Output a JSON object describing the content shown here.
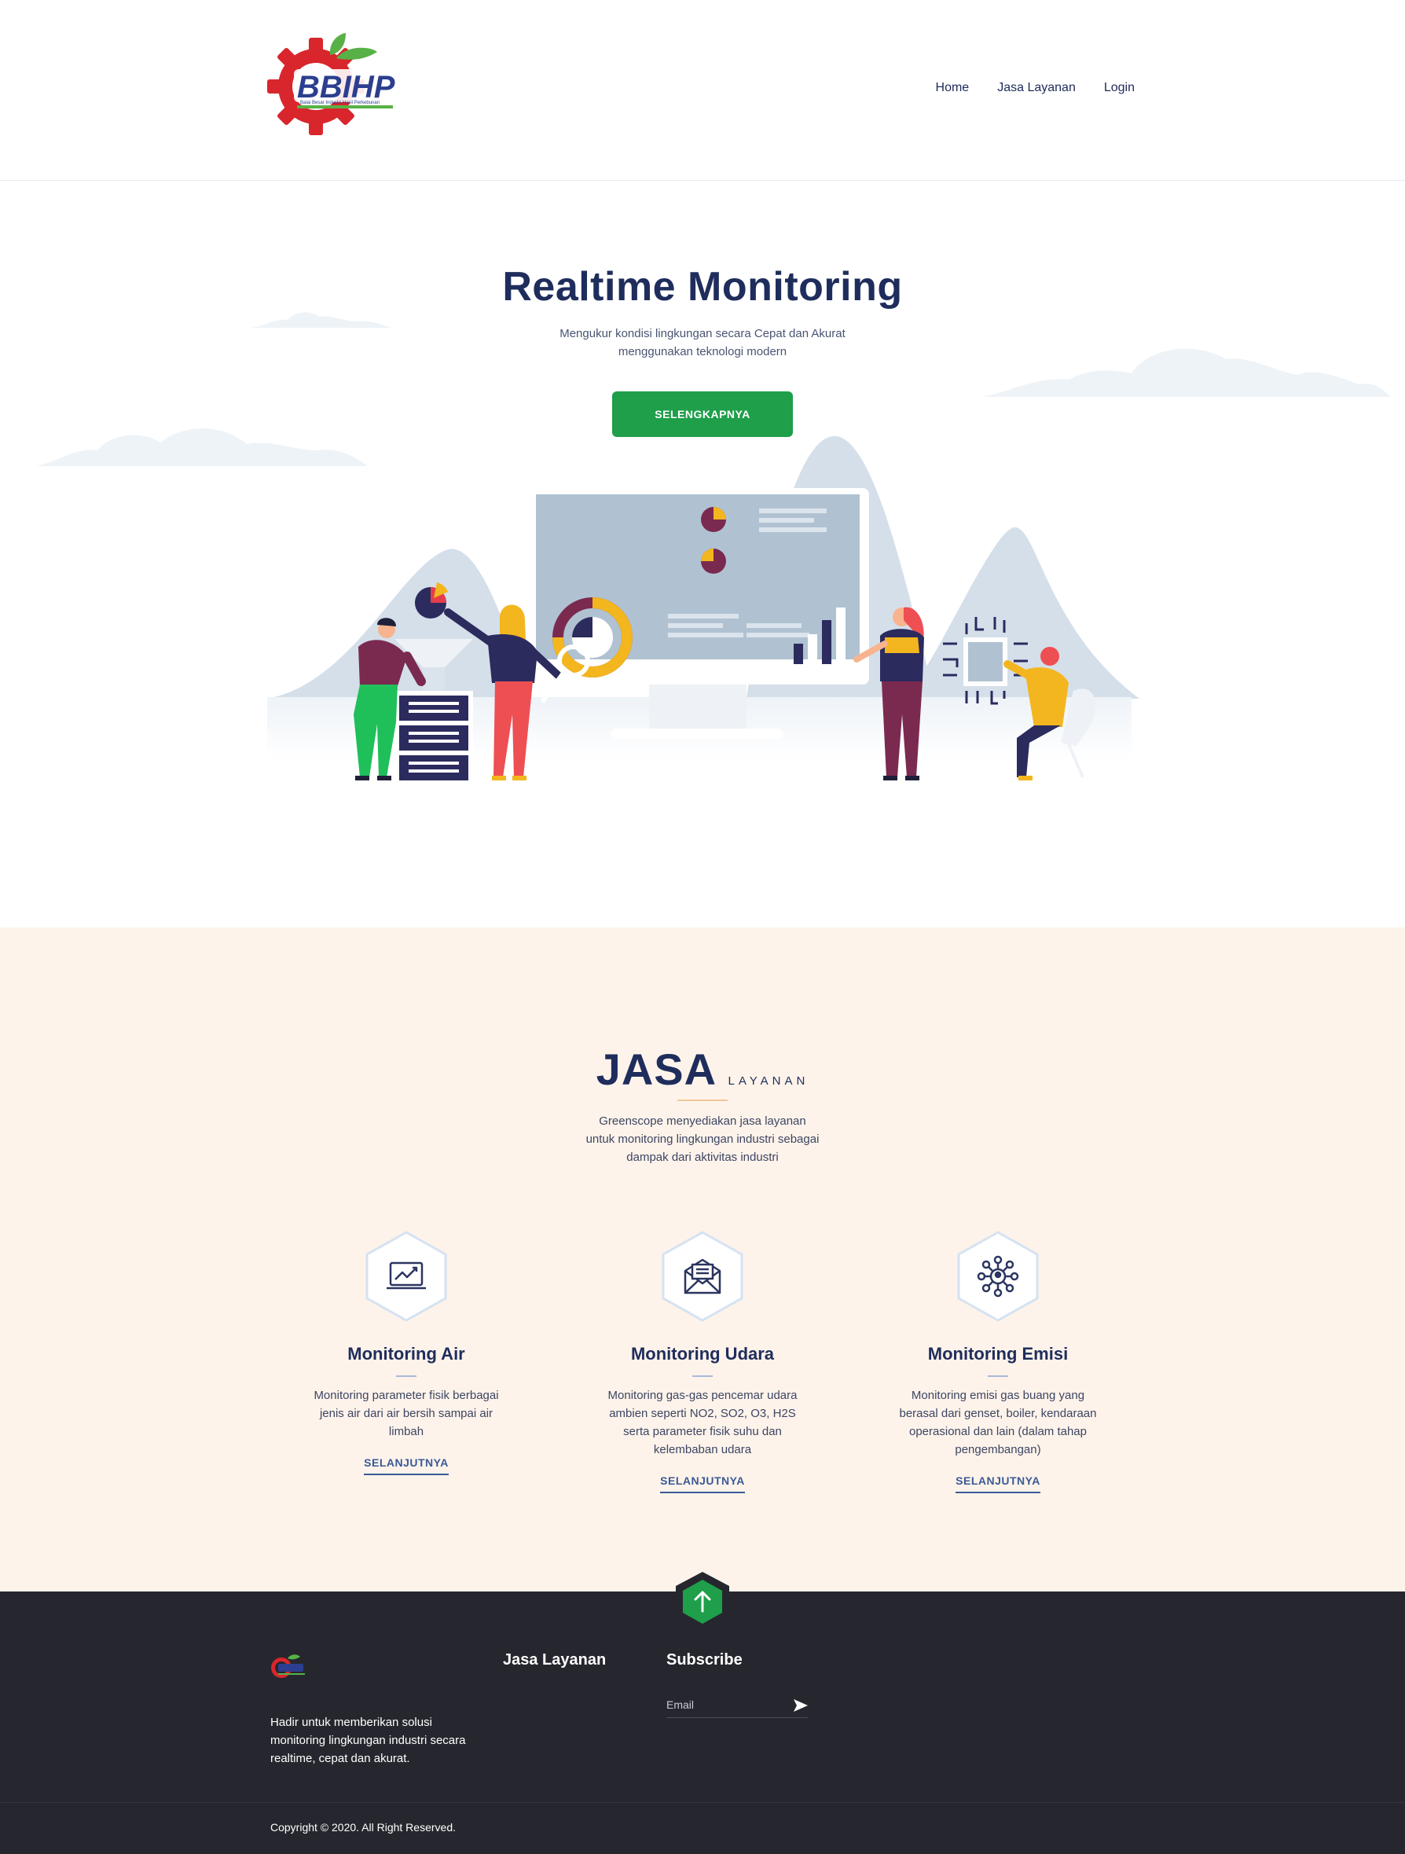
{
  "header": {
    "logo_text": "BBIHP",
    "logo_subtext": "Balai Besar Industri Hasil Perkebunan",
    "nav": [
      "Home",
      "Jasa Layanan",
      "Login"
    ]
  },
  "hero": {
    "title": "Realtime Monitoring",
    "subtitle_line1": "Mengukur kondisi lingkungan secara Cepat dan Akurat",
    "subtitle_line2": "menggunakan teknologi modern",
    "button": "SELENGKAPNYA"
  },
  "services": {
    "title": "JASA",
    "title_small": "LAYANAN",
    "description": "Greenscope menyediakan jasa layanan untuk monitoring lingkungan industri sebagai dampak dari aktivitas industri",
    "cards": [
      {
        "icon": "chart-monitor-icon",
        "title": "Monitoring Air",
        "text": "Monitoring parameter fisik berbagai jenis air dari air bersih sampai air limbah",
        "link": "SELANJUTNYA"
      },
      {
        "icon": "envelope-icon",
        "title": "Monitoring Udara",
        "text": "Monitoring gas-gas pencemar udara ambien seperti NO2, SO2, O3, H2S serta parameter fisik suhu dan kelembaban udara",
        "link": "SELANJUTNYA"
      },
      {
        "icon": "network-icon",
        "title": "Monitoring Emisi",
        "text": "Monitoring emisi gas buang yang berasal dari genset, boiler, kendaraan operasional dan lain (dalam tahap pengembangan)",
        "link": "SELANJUTNYA"
      }
    ]
  },
  "footer": {
    "about": "Hadir untuk memberikan solusi monitoring lingkungan industri secara realtime, cepat dan akurat.",
    "col_services": "Jasa Layanan",
    "col_subscribe": "Subscribe",
    "email_placeholder": "Email",
    "copyright": "Copyright © 2020. All Right Reserved."
  },
  "colors": {
    "brand_green": "#1f9f4a",
    "navy": "#1f2d5c",
    "services_bg": "#fdf3ea",
    "footer_bg": "#26272e"
  }
}
